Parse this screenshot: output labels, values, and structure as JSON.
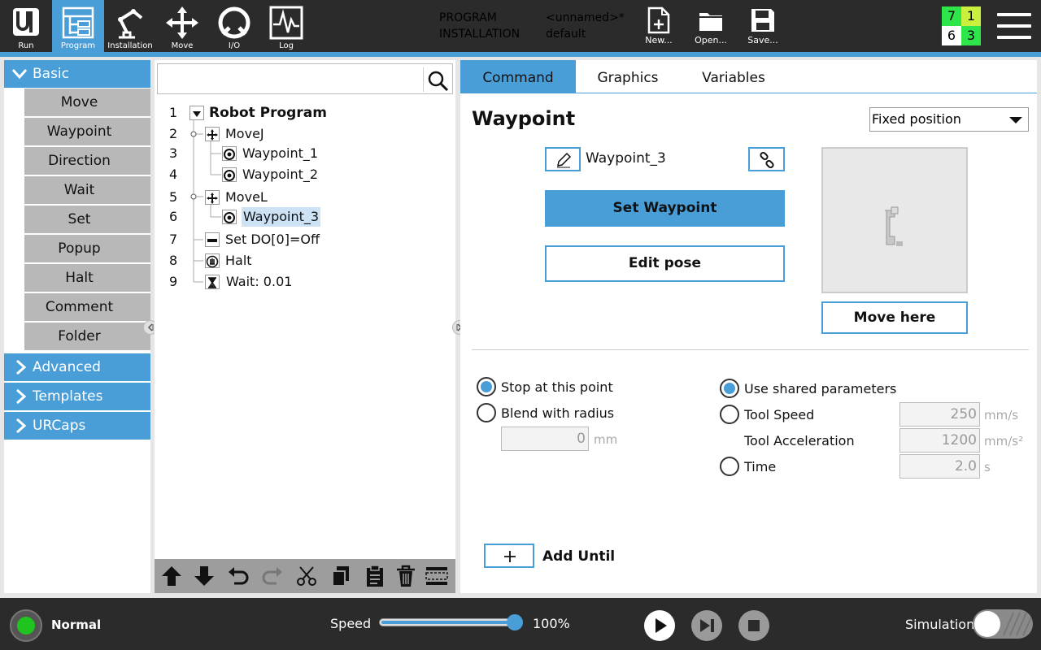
{
  "nav": {
    "run": "Run",
    "program": "Program",
    "installation": "Installation",
    "move": "Move",
    "io": "I/O",
    "log": "Log",
    "active": "program"
  },
  "header": {
    "program_label": "PROGRAM",
    "program_value": "<unnamed>*",
    "installation_label": "INSTALLATION",
    "installation_value": "default",
    "new": "New...",
    "open": "Open...",
    "save": "Save..."
  },
  "counters": {
    "top_left": "7",
    "top_right": "1",
    "bottom_left": "6",
    "bottom_right": "3",
    "colors": {
      "green": "#2ee64a",
      "yellow_green": "#c8f03c",
      "white": "#ffffff"
    }
  },
  "toolbox": {
    "basic": "Basic",
    "items": [
      "Move",
      "Waypoint",
      "Direction",
      "Wait",
      "Set",
      "Popup",
      "Halt",
      "Comment",
      "Folder"
    ],
    "advanced": "Advanced",
    "templates": "Templates",
    "urcaps": "URCaps"
  },
  "tree": {
    "search_placeholder": "",
    "rows": [
      {
        "num": "1",
        "text": "Robot Program",
        "icon": "collapse-triangle-icon"
      },
      {
        "num": "2",
        "text": "MoveJ",
        "icon": "move-arrows-icon"
      },
      {
        "num": "3",
        "text": "Waypoint_1",
        "icon": "waypoint-icon"
      },
      {
        "num": "4",
        "text": "Waypoint_2",
        "icon": "waypoint-icon"
      },
      {
        "num": "5",
        "text": "MoveL",
        "icon": "move-arrows-icon"
      },
      {
        "num": "6",
        "text": "Waypoint_3",
        "icon": "waypoint-icon",
        "selected": true
      },
      {
        "num": "7",
        "text": "Set DO[0]=Off",
        "icon": "set-icon"
      },
      {
        "num": "8",
        "text": "Halt",
        "icon": "halt-hand-icon"
      },
      {
        "num": "9",
        "text": "Wait: 0.01",
        "icon": "hourglass-icon"
      }
    ]
  },
  "tabs": {
    "command": "Command",
    "graphics": "Graphics",
    "variables": "Variables"
  },
  "waypoint": {
    "title": "Waypoint",
    "type_select": "Fixed position",
    "name": "Waypoint_3",
    "set_waypoint": "Set Waypoint",
    "edit_pose": "Edit pose",
    "move_here": "Move here",
    "stop_at_point": "Stop at this point",
    "blend_with_radius": "Blend with radius",
    "blend_value": "0",
    "blend_unit": "mm",
    "use_shared": "Use shared parameters",
    "tool_speed": "Tool Speed",
    "tool_speed_value": "250",
    "tool_speed_unit": "mm/s",
    "tool_accel": "Tool Acceleration",
    "tool_accel_value": "1200",
    "tool_accel_unit": "mm/s²",
    "time": "Time",
    "time_value": "2.0",
    "time_unit": "s",
    "add_until": "Add Until"
  },
  "footer": {
    "status": "Normal",
    "speed_label": "Speed",
    "speed_value": "100%",
    "speed_fraction": 1.0,
    "simulation": "Simulation"
  },
  "colors": {
    "accent": "#4a9ed8",
    "topbar": "#2b2b2b",
    "status_green": "#1fc41f"
  }
}
